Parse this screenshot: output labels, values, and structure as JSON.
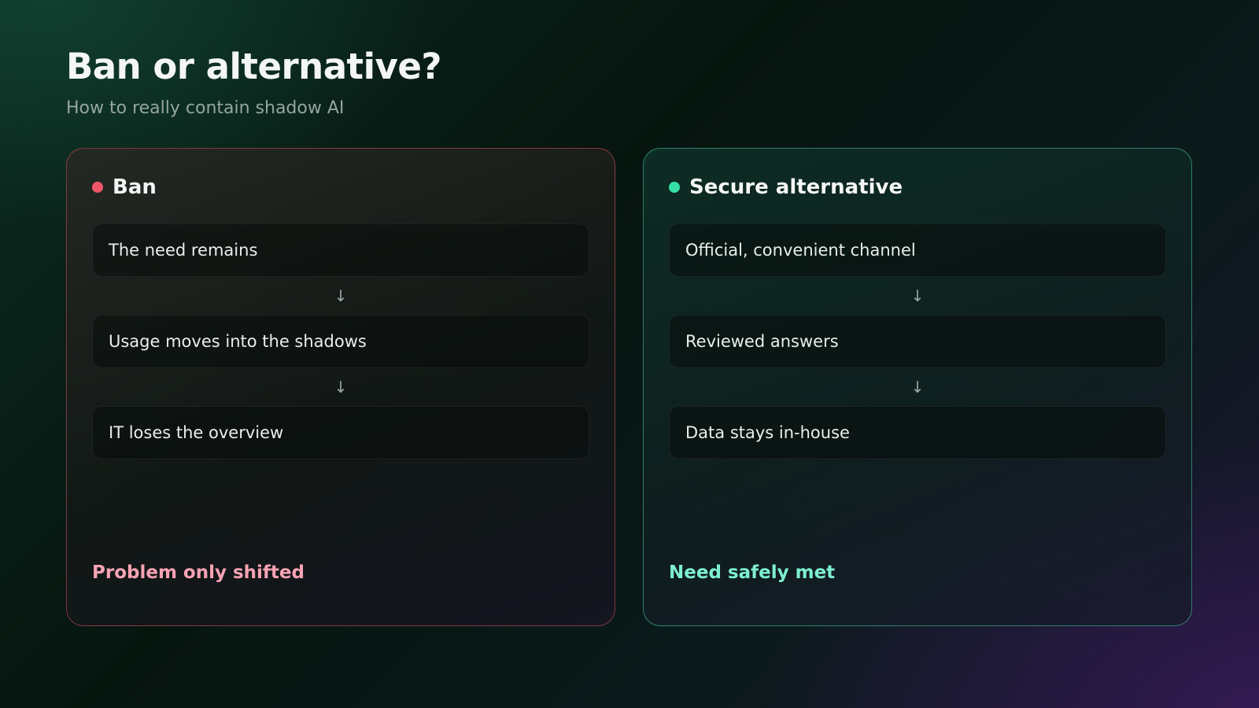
{
  "header": {
    "title": "Ban or alternative?",
    "subtitle": "How to really contain shadow AI"
  },
  "colors": {
    "ban_accent": "#f0566a",
    "alternative_accent": "#35e0a6",
    "ban_footer": "#f7a3b4",
    "alternative_footer": "#7df0cf"
  },
  "panels": {
    "ban": {
      "title": "Ban",
      "steps": [
        "The need remains",
        "Usage moves into the shadows",
        "IT loses the overview"
      ],
      "arrow": "↓",
      "footer": "Problem only shifted"
    },
    "alternative": {
      "title": "Secure alternative",
      "steps": [
        "Official, convenient channel",
        "Reviewed answers",
        "Data stays in-house"
      ],
      "arrow": "↓",
      "footer": "Need safely met"
    }
  }
}
